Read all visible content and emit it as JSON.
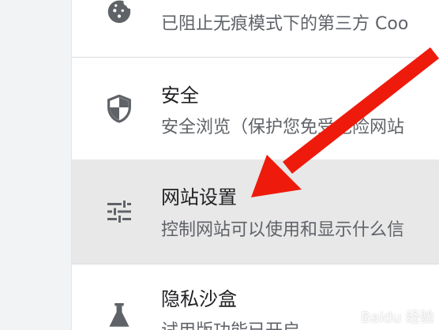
{
  "rows": {
    "cookies": {
      "icon": "cookie-icon",
      "subtitle": "已阻止无痕模式下的第三方 Coo"
    },
    "security": {
      "icon": "shield-icon",
      "title": "安全",
      "subtitle": "安全浏览（保护您免受危险网站"
    },
    "site_settings": {
      "icon": "tune-sliders-icon",
      "title": "网站设置",
      "subtitle": "控制网站可以使用和显示什么信"
    },
    "privacy_sandbox": {
      "icon": "flask-icon",
      "title": "隐私沙盒",
      "subtitle": "试用版功能已开启"
    }
  },
  "colors": {
    "annotation_arrow": "#ee1b0c",
    "highlight_row": "#e8e8e8",
    "icon": "#5f6368"
  },
  "watermark": {
    "text": "Baidu 经验"
  }
}
